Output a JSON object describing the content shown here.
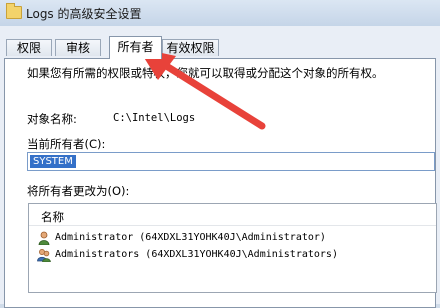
{
  "window": {
    "title": "Logs 的高级安全设置"
  },
  "tabs": [
    {
      "label": "权限"
    },
    {
      "label": "审核"
    },
    {
      "label": "所有者"
    },
    {
      "label": "有效权限"
    }
  ],
  "owner_tab": {
    "intro": "如果您有所需的权限或特权，您就可以取得或分配这个对象的所有权。",
    "object_name_label": "对象名称:",
    "object_name_value": "C:\\Intel\\Logs",
    "current_owner_label": "当前所有者(C):",
    "current_owner_value": "SYSTEM",
    "change_owner_label": "将所有者更改为(O):",
    "list_header": "名称",
    "owners": [
      {
        "name": "Administrator (64XDXL31YOHK40J\\Administrator)",
        "icon": "user-icon"
      },
      {
        "name": "Administrators (64XDXL31YOHK40J\\Administrators)",
        "icon": "group-icon"
      }
    ]
  },
  "annotation": {
    "color": "#e8423a",
    "icon": "red-arrow-pointer"
  },
  "colors": {
    "selection": "#3470c8",
    "panel_border": "#8796aa"
  }
}
